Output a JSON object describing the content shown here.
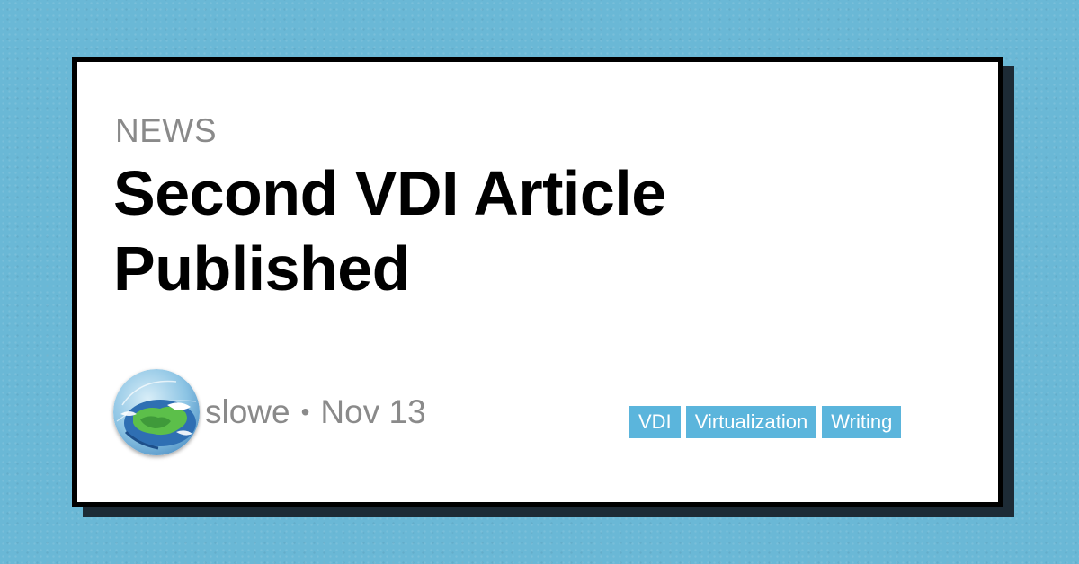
{
  "card": {
    "category": "NEWS",
    "title": "Second VDI Article Published"
  },
  "meta": {
    "author": "slowe",
    "separator": "•",
    "date": "Nov 13",
    "avatar_icon": "globe-avatar-icon"
  },
  "tags": [
    "VDI",
    "Virtualization",
    "Writing"
  ],
  "colors": {
    "background": "#6ab8d6",
    "card": "#ffffff",
    "border": "#000000",
    "tag": "#5bb5dc",
    "muted_text": "#8a8a8a"
  }
}
